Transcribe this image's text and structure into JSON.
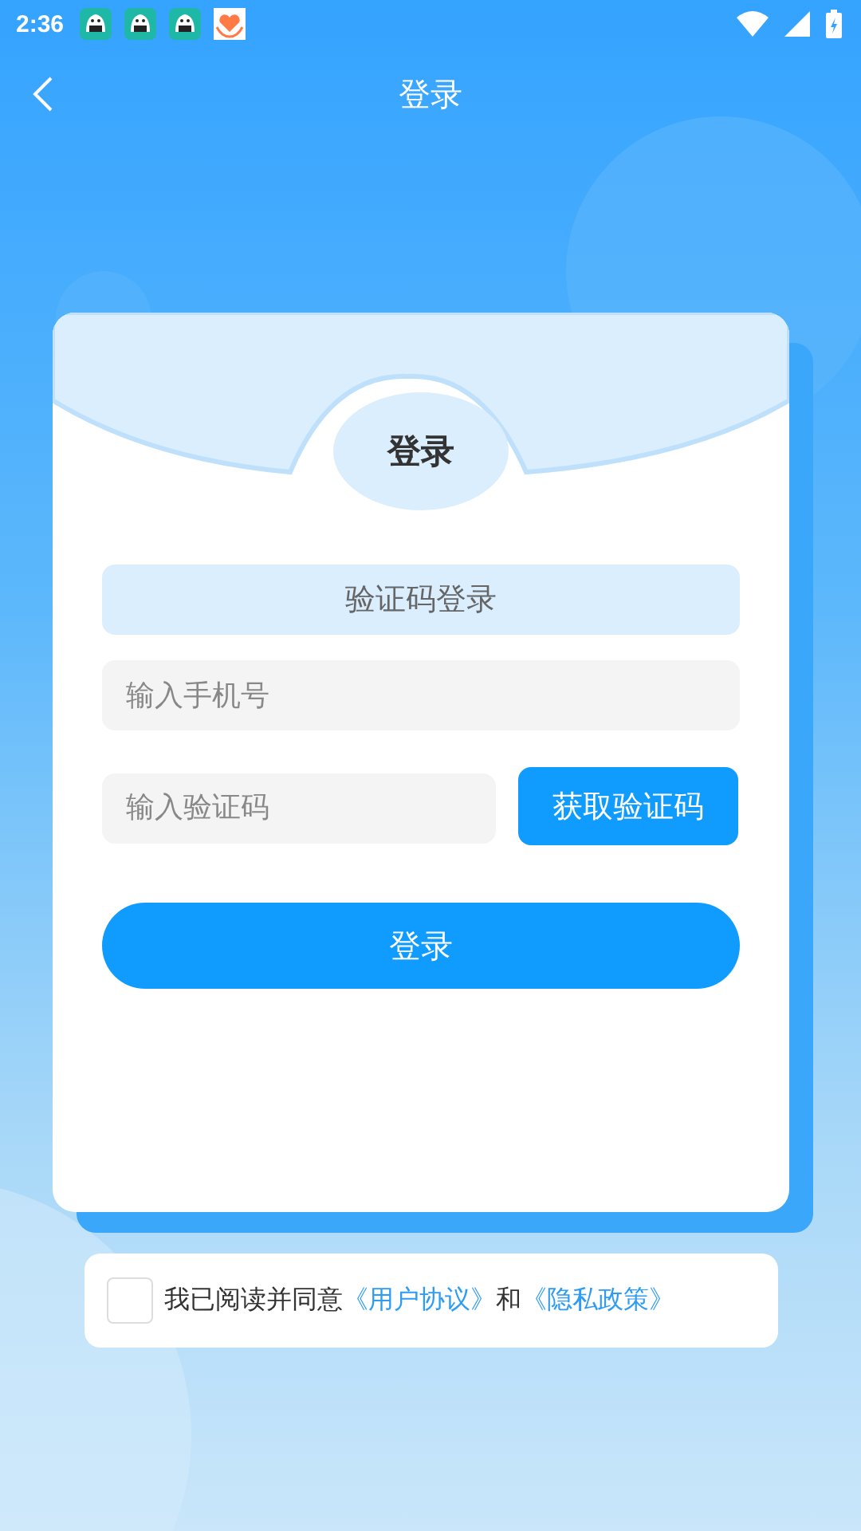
{
  "status_bar": {
    "time": "2:36"
  },
  "header": {
    "title": "登录"
  },
  "card": {
    "title": "登录",
    "mode_tab": {
      "label": "验证码登录",
      "selected": true
    },
    "phone_field": {
      "placeholder": "输入手机号"
    },
    "code_field": {
      "placeholder": "输入验证码"
    },
    "get_code_button": "获取验证码",
    "login_button": "登录"
  },
  "agreement": {
    "checked": false,
    "text": "我已阅读并同意",
    "link_1": "《用户协议》",
    "joiner": "和",
    "link_2": "《隐私政策》"
  }
}
